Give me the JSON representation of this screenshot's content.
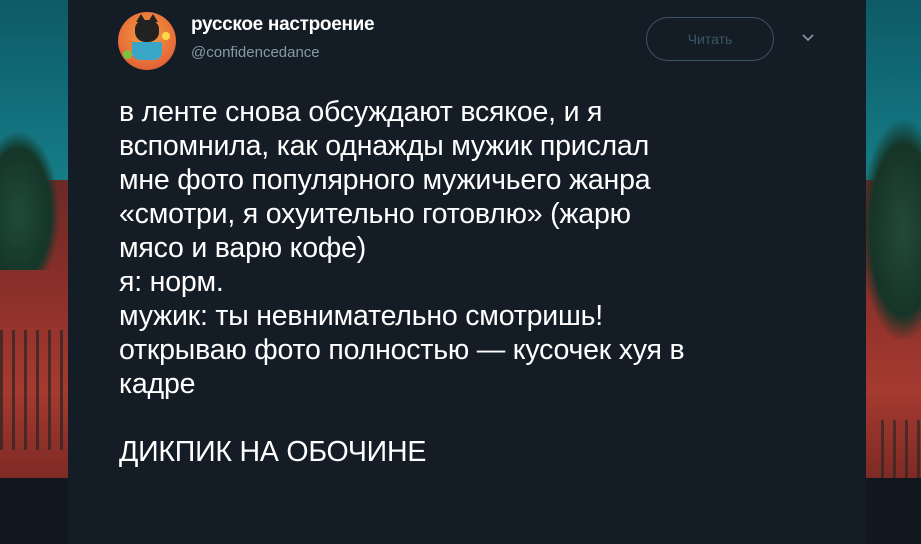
{
  "author": {
    "display_name": "русское настроение",
    "username": "@confidencedance"
  },
  "follow_button": {
    "label": "Читать"
  },
  "menu": {
    "icon": "chevron-down-icon"
  },
  "tweet": {
    "lines": [
      "в ленте снова обсуждают всякое, и я",
      "вспомнила, как однажды мужик прислал",
      "мне фото популярного мужичьего жанра",
      "«смотри, я охуительно готовлю» (жарю",
      "мясо и варю кофе)",
      "я: норм.",
      "мужик: ты невнимательно смотришь!",
      "открываю фото полностью — кусочек хуя в",
      "кадре"
    ],
    "closing_line": "ДИКПИК НА ОБОЧИНЕ"
  },
  "colors": {
    "card_background": "#141d26",
    "text": "#ffffff",
    "secondary_text": "#8899a6",
    "button_border": "#3d5466"
  }
}
